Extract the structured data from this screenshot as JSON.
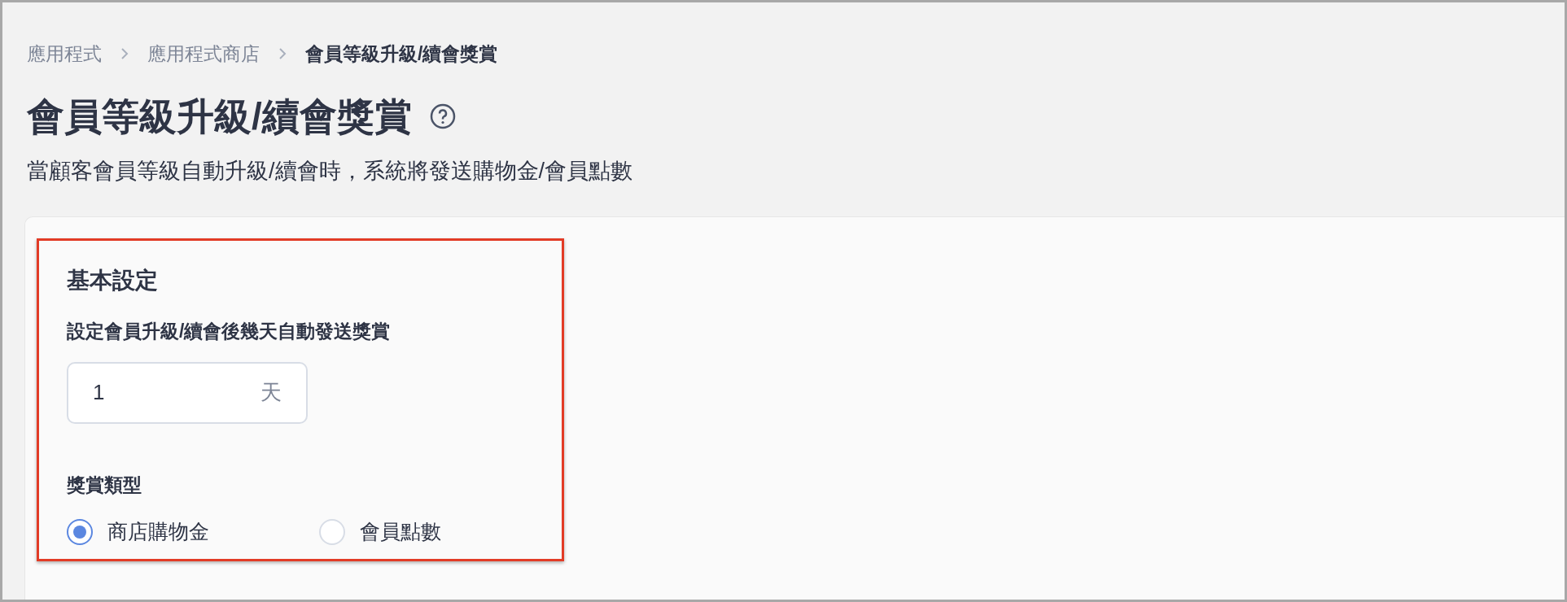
{
  "breadcrumb": [
    {
      "label": "應用程式",
      "current": false
    },
    {
      "label": "應用程式商店",
      "current": false
    },
    {
      "label": "會員等級升級/續會獎賞",
      "current": true
    }
  ],
  "page": {
    "title": "會員等級升級/續會獎賞",
    "subtitle": "當顧客會員等級自動升級/續會時，系統將發送購物金/會員點數"
  },
  "section": {
    "title": "基本設定",
    "days_label": "設定會員升級/續會後幾天自動發送獎賞",
    "days_value": "1",
    "days_unit": "天",
    "reward_type_label": "獎賞類型",
    "reward_options": [
      {
        "label": "商店購物金",
        "selected": true
      },
      {
        "label": "會員點數",
        "selected": false
      }
    ]
  }
}
